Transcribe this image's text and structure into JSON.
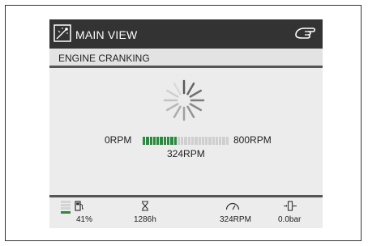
{
  "header": {
    "title": "MAIN VIEW",
    "title_icon": "monitor-signal-icon",
    "hand_icon": "hand-pointer-icon"
  },
  "subtitle": "ENGINE CRANKING",
  "gauge": {
    "min_label": "0RPM",
    "max_label": "800RPM",
    "current_label": "324RPM",
    "fill_fraction": 0.4,
    "segments_total": 25
  },
  "footer": {
    "fuel": {
      "icon": "fuel-pump-icon",
      "value": "41%",
      "level_fraction": 0.41
    },
    "hours": {
      "icon": "hourglass-icon",
      "value": "1286h"
    },
    "rpm": {
      "icon": "gauge-icon",
      "value": "324RPM"
    },
    "pressure": {
      "icon": "oil-pressure-icon",
      "value": "0.0bar"
    }
  },
  "colors": {
    "titlebar": "#333333",
    "screen": "#ececec",
    "bar_on": "#2b8a3e",
    "bar_off": "#cfcfcf"
  }
}
